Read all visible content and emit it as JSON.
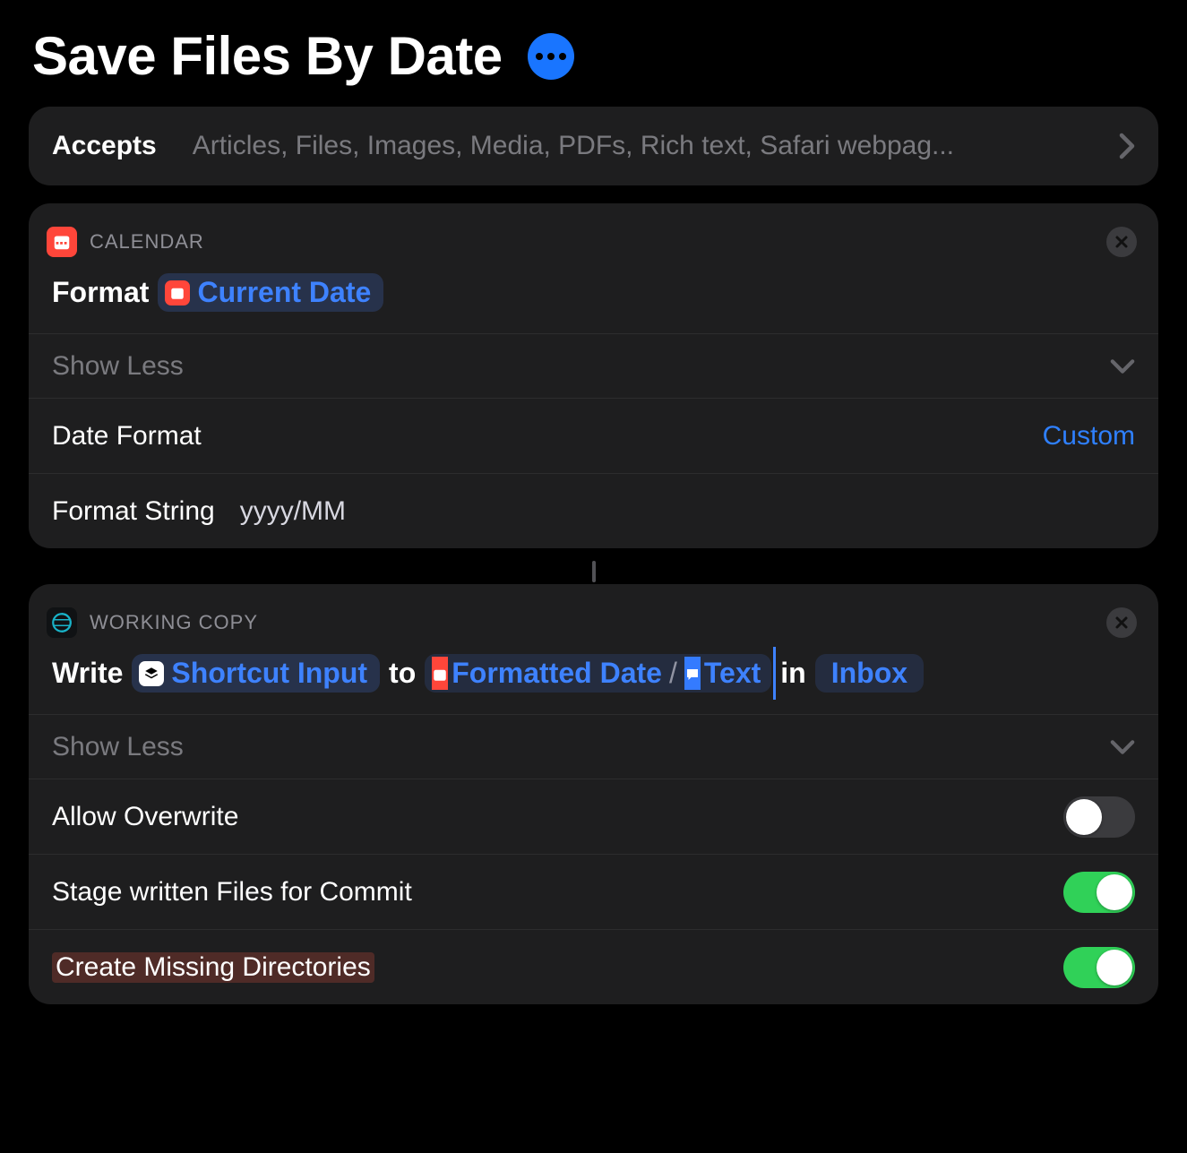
{
  "title": "Save Files By Date",
  "accepts": {
    "label": "Accepts",
    "value": "Articles, Files, Images, Media, PDFs, Rich text, Safari webpag..."
  },
  "actions": [
    {
      "app": "CALENDAR",
      "line": {
        "verb": "Format",
        "arg_token": "Current Date"
      },
      "show_less": "Show Less",
      "options": [
        {
          "label": "Date Format",
          "value": "Custom",
          "kind": "link"
        },
        {
          "label": "Format String",
          "value": "yyyy/MM",
          "kind": "plain"
        }
      ]
    },
    {
      "app": "WORKING COPY",
      "line": {
        "w_write": "Write",
        "tok_input": "Shortcut Input",
        "w_to": "to",
        "tok_date": "Formatted Date",
        "tok_text": "Text",
        "w_in": "in",
        "tok_repo": "Inbox"
      },
      "show_less": "Show Less",
      "options": [
        {
          "label": "Allow Overwrite",
          "kind": "toggle",
          "on": false
        },
        {
          "label": "Stage written Files for Commit",
          "kind": "toggle",
          "on": true
        },
        {
          "label": "Create Missing Directories",
          "kind": "toggle",
          "on": true,
          "highlight": true
        }
      ]
    }
  ]
}
